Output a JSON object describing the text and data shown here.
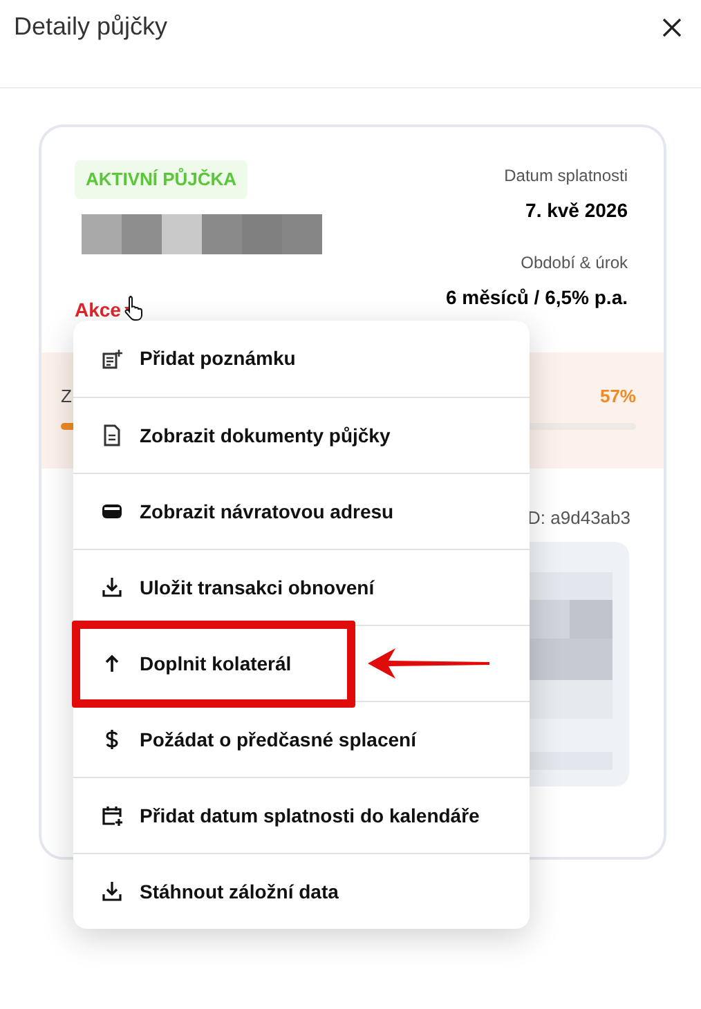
{
  "dialog": {
    "title": "Detaily půjčky"
  },
  "loan": {
    "status_badge": "AKTIVNÍ PŮJČKA",
    "due_label": "Datum splatnosti",
    "due_value": "7. kvě 2026",
    "term_label": "Období & úrok",
    "term_value": "6 měsíců / 6,5% p.a.",
    "actions_label": "Akce",
    "ltv": {
      "label": "Z",
      "value": "57%",
      "level": 0.57
    },
    "id_text": "D: a9d43ab3"
  },
  "menu": {
    "items": [
      {
        "label": "Přidat poznámku",
        "kind": "note",
        "highlighted": false
      },
      {
        "label": "Zobrazit dokumenty půjčky",
        "kind": "document",
        "highlighted": false
      },
      {
        "label": "Zobrazit návratovou adresu",
        "kind": "wallet",
        "highlighted": false
      },
      {
        "label": "Uložit transakci obnovení",
        "kind": "download",
        "highlighted": false
      },
      {
        "label": "Doplnit kolaterál",
        "kind": "up",
        "highlighted": true
      },
      {
        "label": "Požádat o předčasné splacení",
        "kind": "dollar",
        "highlighted": false
      },
      {
        "label": "Přidat datum splatnosti do kalendáře",
        "kind": "calendar",
        "highlighted": false
      },
      {
        "label": "Stáhnout záložní data",
        "kind": "download",
        "highlighted": false
      }
    ]
  }
}
